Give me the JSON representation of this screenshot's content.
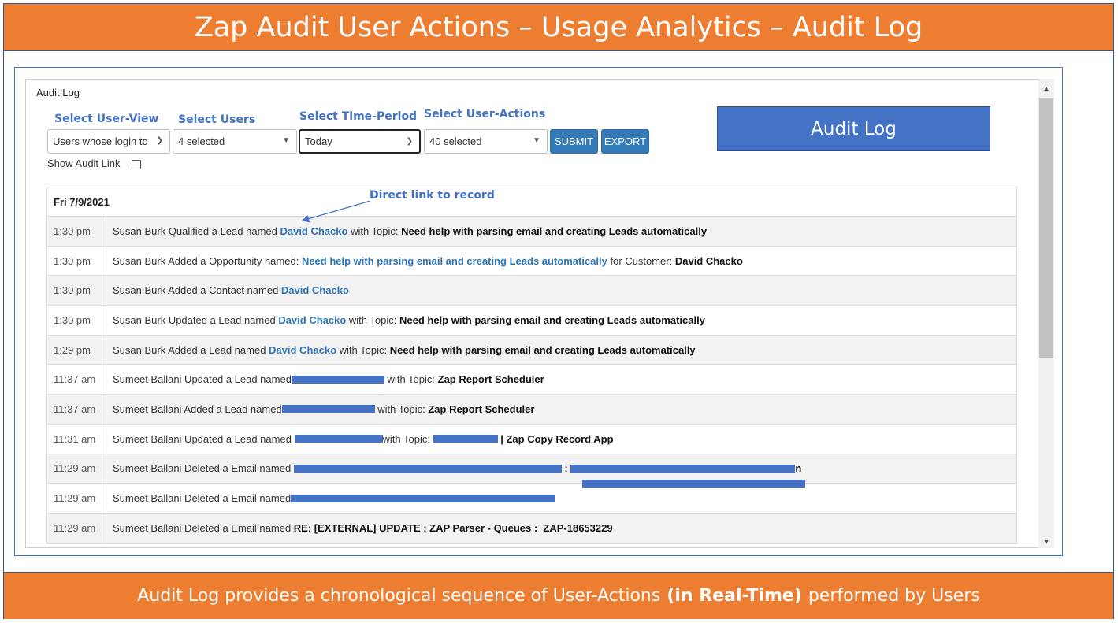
{
  "header": {
    "title": "Zap Audit User Actions – Usage Analytics – Audit Log"
  },
  "footer": {
    "text_before": "Audit Log provides a chronological sequence of User-Actions",
    "text_bold": "(in Real-Time)",
    "text_after": "performed by Users"
  },
  "panel": {
    "title": "Audit Log"
  },
  "controls": {
    "user_view": {
      "label": "Select User-View",
      "value": "Users whose login tc"
    },
    "users": {
      "label": "Select Users",
      "value": "4 selected"
    },
    "time_period": {
      "label": "Select Time-Period",
      "value": "Today"
    },
    "user_actions": {
      "label": "Select User-Actions",
      "value": "40 selected"
    },
    "submit_label": "SUBMIT",
    "export_label": "EXPORT",
    "show_audit_link_label": "Show Audit Link"
  },
  "callout": {
    "label": "Audit Log"
  },
  "annotation": {
    "text": "Direct link to record"
  },
  "log": {
    "date": "Fri 7/9/2021",
    "rows": [
      {
        "time": "1:30 pm",
        "parts": [
          {
            "t": "Susan Burk Qualified a Lead named ",
            "s": "plain"
          },
          {
            "t": "David Chacko",
            "s": "link"
          },
          {
            "t": " with Topic: ",
            "s": "plain"
          },
          {
            "t": "Need help with parsing email and creating Leads automatically",
            "s": "bold"
          }
        ]
      },
      {
        "time": "1:30 pm",
        "parts": [
          {
            "t": "Susan Burk Added a Opportunity named: ",
            "s": "plain"
          },
          {
            "t": "Need help with parsing email and creating Leads automatically",
            "s": "link"
          },
          {
            "t": " for Customer: ",
            "s": "plain"
          },
          {
            "t": "David Chacko",
            "s": "bold"
          }
        ]
      },
      {
        "time": "1:30 pm",
        "parts": [
          {
            "t": "Susan Burk Added a Contact named ",
            "s": "plain"
          },
          {
            "t": "David Chacko",
            "s": "link"
          }
        ]
      },
      {
        "time": "1:30 pm",
        "parts": [
          {
            "t": "Susan Burk Updated a Lead named ",
            "s": "plain"
          },
          {
            "t": "David Chacko",
            "s": "link"
          },
          {
            "t": " with Topic: ",
            "s": "plain"
          },
          {
            "t": "Need help with parsing email and creating Leads automatically",
            "s": "bold"
          }
        ]
      },
      {
        "time": "1:29 pm",
        "parts": [
          {
            "t": "Susan Burk Added a Lead named ",
            "s": "plain"
          },
          {
            "t": "David Chacko",
            "s": "link"
          },
          {
            "t": " with Topic: ",
            "s": "plain"
          },
          {
            "t": "Need help with parsing email and creating Leads automatically",
            "s": "bold"
          }
        ]
      },
      {
        "time": "11:37 am",
        "parts": [
          {
            "t": "Sumeet Ballani Updated a Lead named",
            "s": "plain"
          },
          {
            "t": "",
            "s": "redact",
            "w": 118
          },
          {
            "t": " with Topic: ",
            "s": "plain"
          },
          {
            "t": "Zap Report Scheduler",
            "s": "bold"
          }
        ]
      },
      {
        "time": "11:37 am",
        "parts": [
          {
            "t": "Sumeet Ballani Added a Lead named",
            "s": "plain"
          },
          {
            "t": "",
            "s": "redact",
            "w": 118
          },
          {
            "t": " with Topic: ",
            "s": "plain"
          },
          {
            "t": "Zap Report Scheduler",
            "s": "bold"
          }
        ]
      },
      {
        "time": "11:31 am",
        "parts": [
          {
            "t": "Sumeet Ballani Updated a Lead named ",
            "s": "plain"
          },
          {
            "t": "",
            "s": "redact",
            "w": 112
          },
          {
            "t": "with Topic: ",
            "s": "plain"
          },
          {
            "t": "",
            "s": "redact",
            "w": 82
          },
          {
            "t": " | Zap Copy Record App",
            "s": "bold"
          }
        ]
      },
      {
        "time": "11:29 am",
        "parts": [
          {
            "t": "Sumeet Ballani Deleted a Email named ",
            "s": "plain"
          },
          {
            "t": "",
            "s": "redact",
            "w": 340
          },
          {
            "t": " : ",
            "s": "bold"
          },
          {
            "t": "",
            "s": "redact",
            "w": 285
          },
          {
            "t": "n",
            "s": "bold"
          }
        ]
      },
      {
        "time": "11:29 am",
        "parts": [
          {
            "t": "Sumeet Ballani Deleted a Email named",
            "s": "plain"
          },
          {
            "t": "",
            "s": "redact",
            "w": 335
          }
        ]
      },
      {
        "time": "11:29 am",
        "parts": [
          {
            "t": "Sumeet Ballani Deleted a Email named ",
            "s": "plain"
          },
          {
            "t": "RE: [EXTERNAL] UPDATE : ZAP Parser - Queues :  ZAP-18653229",
            "s": "bold"
          }
        ]
      }
    ]
  }
}
